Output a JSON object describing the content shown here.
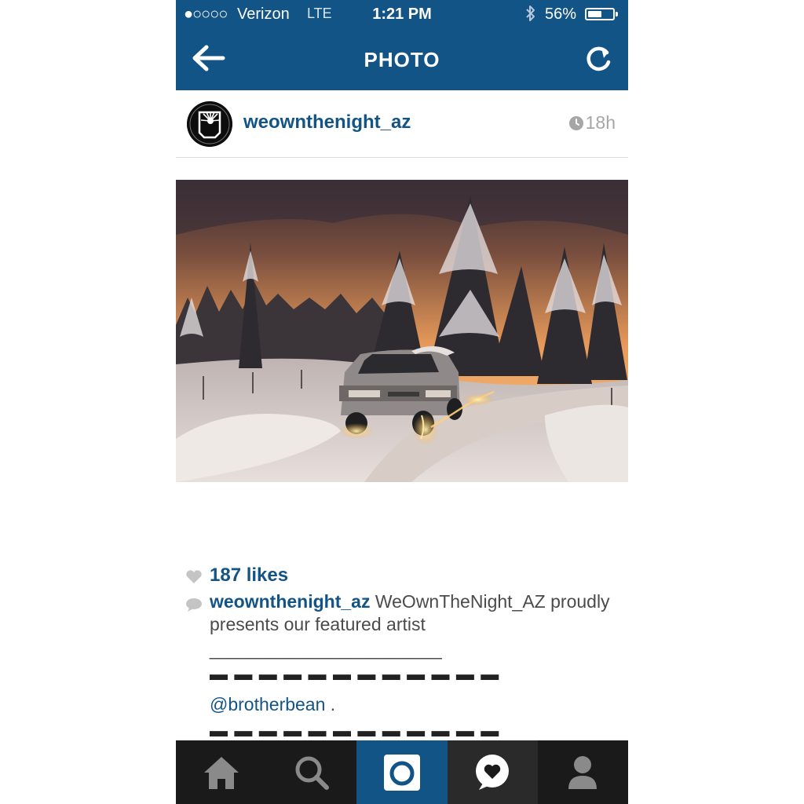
{
  "status_bar": {
    "signal": "●○○○○",
    "carrier": "Verizon",
    "network": "LTE",
    "time": "1:21 PM",
    "battery_percent_label": "56%",
    "battery_level": 0.56
  },
  "nav": {
    "title": "PHOTO"
  },
  "post": {
    "username": "weownthenight_az",
    "time_ago": "18h",
    "likes_label": "187 likes",
    "caption": {
      "author": "weownthenight_az",
      "text": " WeOwnTheNight_AZ proudly presents our featured artist",
      "line1": "_________________________",
      "line2": "▬ ▬ ▬ ▬ ▬ ▬ ▬ ▬ ▬ ▬ ▬ ▬",
      "mention": "@brotherbean",
      "mention_suffix": " .",
      "line3": "▬ ▬ ▬ ▬ ▬ ▬ ▬ ▬ ▬ ▬ ▬ ▬"
    }
  },
  "tabs": [
    {
      "name": "home",
      "icon": "home-icon"
    },
    {
      "name": "search",
      "icon": "search-icon"
    },
    {
      "name": "camera",
      "icon": "camera-icon",
      "active": true
    },
    {
      "name": "activity",
      "icon": "heart-bubble-icon"
    },
    {
      "name": "profile",
      "icon": "profile-icon"
    }
  ],
  "colors": {
    "brand": "#135487",
    "tabbar": "#1a1a1a",
    "muted": "#a6a6a6"
  }
}
